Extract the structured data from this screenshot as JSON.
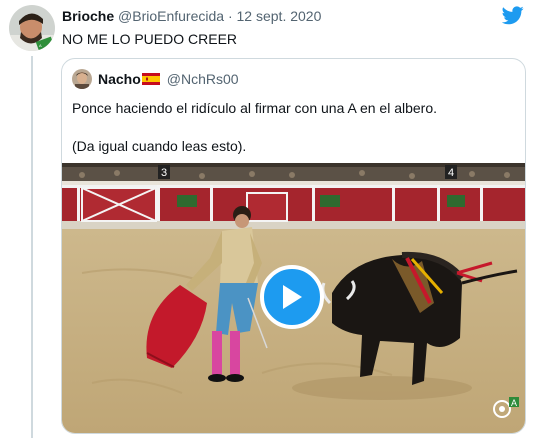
{
  "tweet": {
    "author_name": "Brioche",
    "author_handle": "@BrioEnfurecida",
    "separator": "·",
    "date": "12 sept. 2020",
    "text": "NO ME LO PUEDO CREER"
  },
  "quoted_tweet": {
    "author_name": "Nacho",
    "author_handle": "@NchRs00",
    "text_line1": "Ponce haciendo el ridículo al firmar con una A en el albero.",
    "text_line2": "(Da igual cuando leas esto).",
    "media": {
      "type": "video",
      "scene_left_marker": "3",
      "scene_right_marker": "4",
      "watermark_letter": "A"
    }
  },
  "icons": {
    "brand": "twitter-bird-icon",
    "flag": "spain-flag-icon",
    "play": "play-icon"
  },
  "colors": {
    "twitter_blue": "#1d9bf0",
    "secondary_text": "#536471",
    "border": "#cfd9de"
  }
}
